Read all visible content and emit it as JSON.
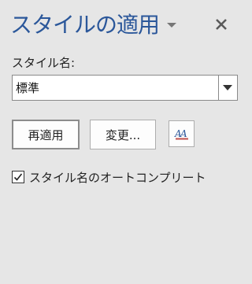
{
  "pane": {
    "title": "スタイルの適用",
    "menu_icon": "chevron-down-icon",
    "close_icon": "close-icon"
  },
  "style_name": {
    "label": "スタイル名:",
    "value": "標準"
  },
  "buttons": {
    "reapply": "再適用",
    "modify": "変更...",
    "style_inspector_icon": "style-inspector-icon"
  },
  "autocomplete": {
    "label": "スタイル名のオートコンプリート",
    "checked": true
  },
  "colors": {
    "title": "#2b579a",
    "background": "#e6e6e6"
  }
}
